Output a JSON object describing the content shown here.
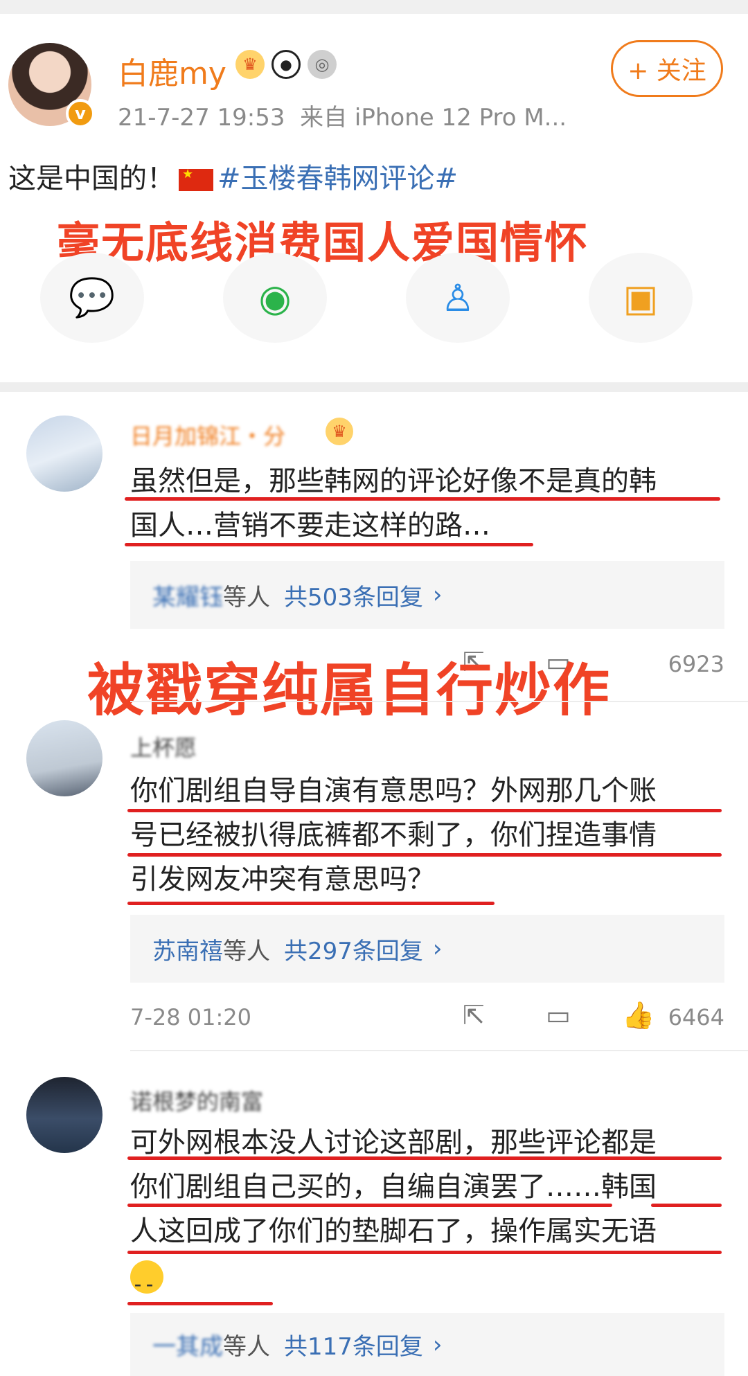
{
  "post": {
    "username": "白鹿my",
    "badges": [
      "crown-icon",
      "panda-icon",
      "medal-icon"
    ],
    "time": "21-7-27 19:53",
    "source": "来自 iPhone 12 Pro M...",
    "follow_label": "+ 关注",
    "text_prefix": "这是中国的！",
    "topic": "#玉楼春韩网评论#",
    "overlay_caption": "毫无底线消费国人爱国情怀",
    "share": [
      "wechat-icon",
      "moments-icon",
      "qq-icon",
      "save-image-icon"
    ]
  },
  "overlay2": "被戳穿纯属自行炒作",
  "comments": [
    {
      "name": "日月加锦江・分",
      "text_line1": "虽然但是，那些韩网的评论好像不是真的韩",
      "text_line2": "国人…营销不要走这样的路…",
      "reply_who": "某耀钰",
      "reply_etc": "等人",
      "reply_count": "共503条回复",
      "partial_likes": "6923"
    },
    {
      "name": "上杯愿",
      "text_line1": "你们剧组自导自演有意思吗？外网那几个账",
      "text_line2": "号已经被扒得底裤都不剩了，你们捏造事情",
      "text_line3": "引发网友冲突有意思吗？",
      "reply_who": "苏南禧",
      "reply_etc": "等人",
      "reply_count": "共297条回复",
      "date": "7-28 01:20",
      "likes": "6464"
    },
    {
      "name": "诺根梦的南富",
      "text_line1": "可外网根本没人讨论这部剧，那些评论都是",
      "text_line2": "你们剧组自己买的，自编自演罢了……韩国",
      "text_line3": "人这回成了你们的垫脚石了，操作属实无语",
      "reply_who": "一其成",
      "reply_etc": "等人",
      "reply_count": "共117条回复"
    }
  ],
  "chev": "›",
  "colors": {
    "accent": "#f07b1b",
    "link": "#3a6fb4",
    "annotation": "#e02020"
  }
}
